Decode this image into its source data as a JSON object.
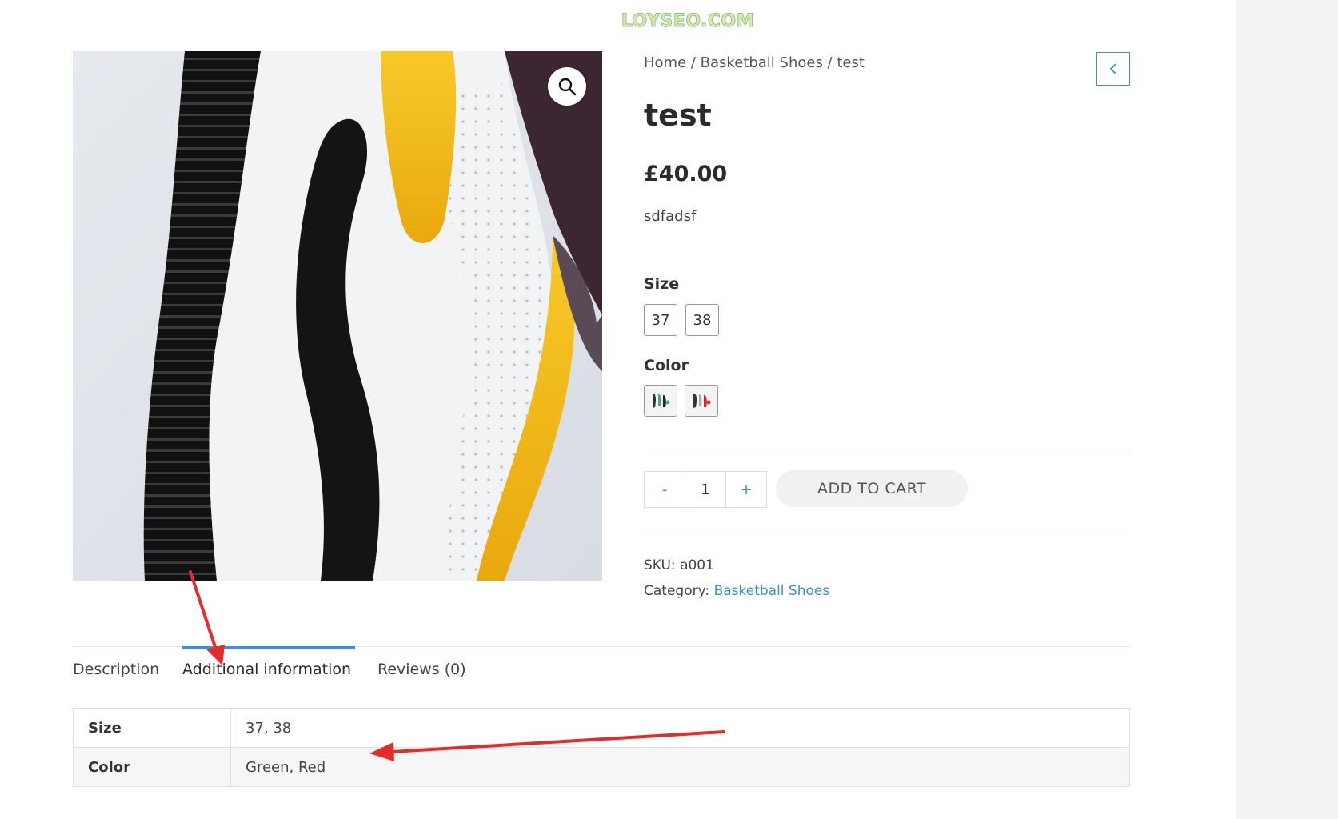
{
  "watermark": "LOYSEO.COM",
  "breadcrumb": [
    "Home",
    "Basketball Shoes",
    "test"
  ],
  "product": {
    "title": "test",
    "price": "£40.00",
    "short_description": "sdfadsf"
  },
  "attributes": {
    "size_label": "Size",
    "sizes": [
      "37",
      "38"
    ],
    "color_label": "Color",
    "colors": [
      "Green",
      "Red"
    ]
  },
  "cart": {
    "qty_minus": "-",
    "qty_value": "1",
    "qty_plus": "+",
    "add_to_cart": "ADD TO CART"
  },
  "meta": {
    "sku_label": "SKU:",
    "sku": "a001",
    "category_label": "Category:",
    "category": "Basketball Shoes"
  },
  "tabs": [
    {
      "label": "Description",
      "active": false
    },
    {
      "label": "Additional information",
      "active": true
    },
    {
      "label": "Reviews (0)",
      "active": false
    }
  ],
  "additional_info": [
    {
      "name": "Size",
      "value": "37, 38"
    },
    {
      "name": "Color",
      "value": "Green, Red"
    }
  ],
  "colors": {
    "accent": "#3a8fd9",
    "annotation": "#e62b2b"
  },
  "icons": {
    "zoom": "magnifier-icon",
    "prev": "chevron-left-icon"
  }
}
